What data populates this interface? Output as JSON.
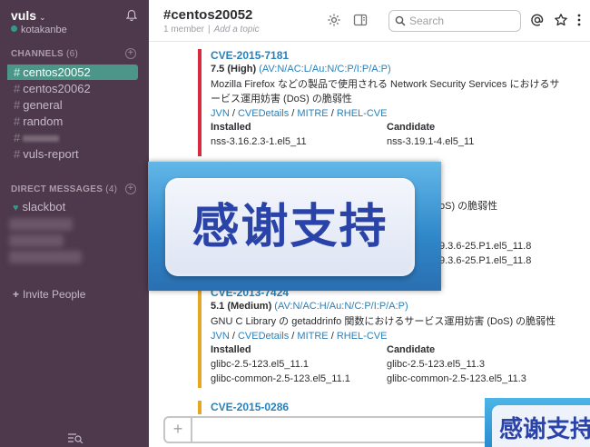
{
  "sidebar": {
    "team_name": "vuls",
    "team_caret": "⌄",
    "user_name": "kotakanbe",
    "channels_label": "CHANNELS",
    "channels_count": "(6)",
    "channels": [
      {
        "name": "centos20052",
        "active": true
      },
      {
        "name": "centos20062",
        "active": false
      },
      {
        "name": "general",
        "active": false
      },
      {
        "name": "random",
        "active": false
      },
      {
        "name": "",
        "blurred": true
      },
      {
        "name": "vuls-report",
        "active": false
      }
    ],
    "dm_label": "DIRECT MESSAGES",
    "dm_count": "(4)",
    "dms": [
      {
        "name": "slackbot"
      }
    ],
    "invite_label": "Invite People",
    "invite_plus": "+"
  },
  "header": {
    "channel_title": "#centos20052",
    "member_count": "1 member",
    "separator": "|",
    "topic": "Add a topic",
    "search_placeholder": "Search"
  },
  "messages": [
    {
      "cve": "CVE-2015-7181",
      "score": "7.5 (High)",
      "vector": "(AV:N/AC:L/Au:N/C:P/I:P/A:P)",
      "desc": "Mozilla Firefox などの製品で使用される Network Security Services におけるサービス運用妨害 (DoS) の脆弱性",
      "links": [
        "JVN",
        "CVEDetails",
        "MITRE",
        "RHEL-CVE"
      ],
      "installed_label": "Installed",
      "candidate_label": "Candidate",
      "rows": [
        [
          "nss-3.16.2.3-1.el5_11",
          "nss-3.19.1-4.el5_11"
        ]
      ]
    },
    {
      "desc_tail": "oS) の脆弱性",
      "rows": [
        [
          "9.3.6-25.P1.el5_11.8"
        ],
        [
          "9.3.6-25.P1.el5_11.8"
        ]
      ]
    },
    {
      "cve": "CVE-2013-7424",
      "score": "5.1 (Medium)",
      "vector": "(AV:N/AC:H/Au:N/C:P/I:P/A:P)",
      "desc": "GNU C Library の getaddrinfo 関数におけるサービス運用妨害 (DoS) の脆弱性",
      "links": [
        "JVN",
        "CVEDetails",
        "MITRE",
        "RHEL-CVE"
      ],
      "installed_label": "Installed",
      "candidate_label": "Candidate",
      "rows": [
        [
          "glibc-2.5-123.el5_11.1",
          "glibc-2.5-123.el5_11.3"
        ],
        [
          "glibc-common-2.5-123.el5_11.1",
          "glibc-common-2.5-123.el5_11.3"
        ]
      ]
    },
    {
      "cve": "CVE-2015-0286"
    }
  ],
  "composer": {
    "plus": "+"
  },
  "overlay": {
    "text": "感谢支持",
    "text2": "感谢支持"
  },
  "colors": {
    "sidebar": "#4d394b",
    "active": "#4c9689",
    "link": "#2a80b9",
    "high": "#d72b3f",
    "medium": "#e8a723"
  }
}
